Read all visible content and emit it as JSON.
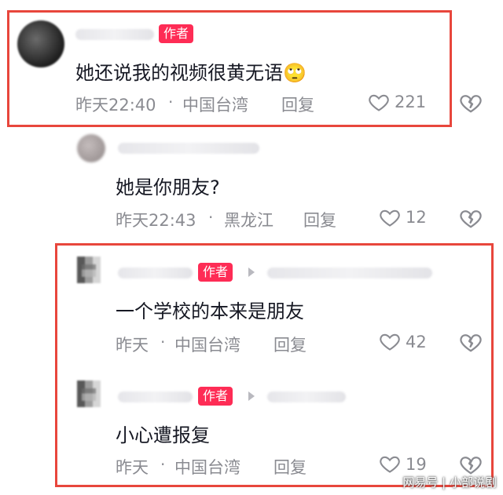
{
  "comments": [
    {
      "badge": "作者",
      "text": "她还说我的视频很黄无语",
      "emoji": "🙄",
      "time": "昨天22:40",
      "location": "中国台湾",
      "reply": "回复",
      "likes": "221"
    },
    {
      "text": "她是你朋友?",
      "time": "昨天22:43",
      "location": "黑龙江",
      "reply": "回复",
      "likes": "12"
    },
    {
      "badge": "作者",
      "text": "一个学校的本来是朋友",
      "time": "昨天",
      "location": "中国台湾",
      "reply": "回复",
      "likes": "42"
    },
    {
      "badge": "作者",
      "text": "小心遭报复",
      "time": "昨天",
      "location": "中国台湾",
      "reply": "回复",
      "likes": "19"
    }
  ],
  "separator": "·",
  "watermark": "网易号 | 小部说剧",
  "colors": {
    "highlight_box": "#e8463c",
    "badge": "#fe2c55",
    "meta_text": "#8a8b91"
  }
}
